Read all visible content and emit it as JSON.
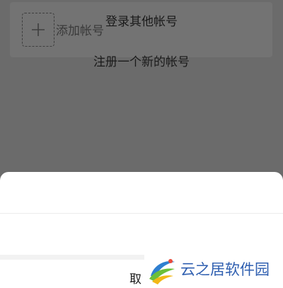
{
  "account_list": {
    "add_account_label": "添加帐号"
  },
  "action_sheet": {
    "options": [
      {
        "label": "登录其他帐号"
      },
      {
        "label": "注册一个新的帐号"
      }
    ],
    "cancel_label": "取消"
  },
  "watermark": {
    "text": "云之居软件园"
  },
  "colors": {
    "overlay": "#6b6b6b",
    "sheet_background": "#ffffff",
    "watermark_text": "#2f5fb0"
  },
  "icons": {
    "add": "plus-icon",
    "watermark_logo": "yunzhiju-logo-icon"
  }
}
